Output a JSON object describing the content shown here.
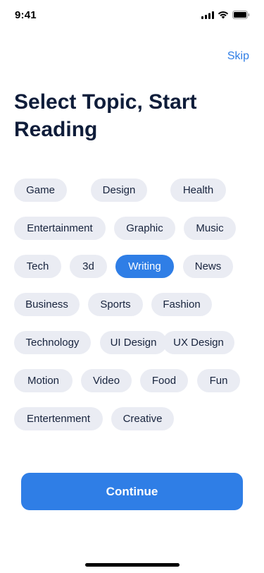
{
  "status_bar": {
    "time": "9:41",
    "icons": [
      "cellular-signal-icon",
      "wifi-icon",
      "battery-icon"
    ]
  },
  "header": {
    "skip_label": "Skip"
  },
  "title": "Select Topic, Start Reading",
  "topics": [
    {
      "label": "Game",
      "selected": false
    },
    {
      "label": "Design",
      "selected": false
    },
    {
      "label": "Health",
      "selected": false
    },
    {
      "label": "Entertainment",
      "selected": false
    },
    {
      "label": "Graphic",
      "selected": false
    },
    {
      "label": "Music",
      "selected": false
    },
    {
      "label": "Tech",
      "selected": false
    },
    {
      "label": "3d",
      "selected": false
    },
    {
      "label": "Writing",
      "selected": true
    },
    {
      "label": "News",
      "selected": false
    },
    {
      "label": "Business",
      "selected": false
    },
    {
      "label": "Sports",
      "selected": false
    },
    {
      "label": "Fashion",
      "selected": false
    },
    {
      "label": "Technology",
      "selected": false
    },
    {
      "label": "UI Design",
      "selected": false
    },
    {
      "label": "UX Design",
      "selected": false
    },
    {
      "label": "Motion",
      "selected": false
    },
    {
      "label": "Video",
      "selected": false
    },
    {
      "label": "Food",
      "selected": false
    },
    {
      "label": "Fun",
      "selected": false
    },
    {
      "label": "Entertenment",
      "selected": false
    },
    {
      "label": "Creative",
      "selected": false
    }
  ],
  "continue_label": "Continue",
  "colors": {
    "accent": "#2f7ee6",
    "chip_background": "#eaecf3",
    "title": "#0f1d3a"
  }
}
